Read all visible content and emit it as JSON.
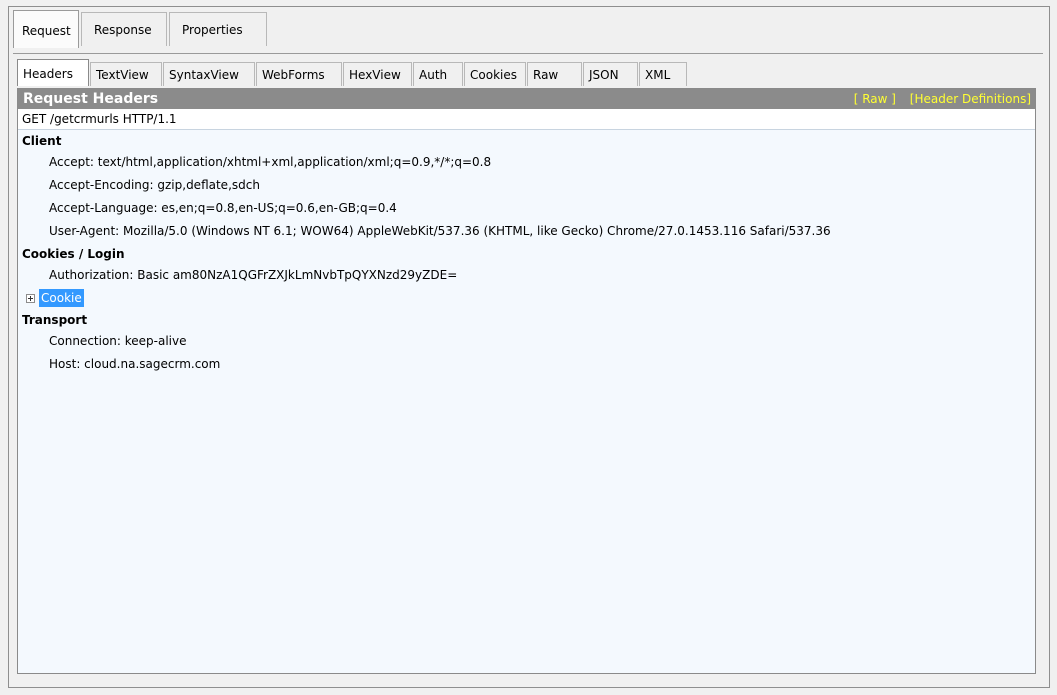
{
  "top_tabs": [
    "Request",
    "Response",
    "Properties"
  ],
  "sub_tabs": [
    "Headers",
    "TextView",
    "SyntaxView",
    "WebForms",
    "HexView",
    "Auth",
    "Cookies",
    "Raw",
    "JSON",
    "XML"
  ],
  "panel": {
    "title": "Request Headers",
    "raw_link": "[ Raw ]",
    "definitions_link": "[Header Definitions]",
    "request_line": "GET /getcrmurls HTTP/1.1"
  },
  "sections": {
    "client": {
      "title": "Client",
      "accept": "Accept: text/html,application/xhtml+xml,application/xml;q=0.9,*/*;q=0.8",
      "accept_encoding": "Accept-Encoding: gzip,deflate,sdch",
      "accept_language": "Accept-Language: es,en;q=0.8,en-US;q=0.6,en-GB;q=0.4",
      "user_agent": "User-Agent: Mozilla/5.0 (Windows NT 6.1; WOW64) AppleWebKit/537.36 (KHTML, like Gecko) Chrome/27.0.1453.116 Safari/537.36"
    },
    "cookies": {
      "title": "Cookies / Login",
      "authorization": "Authorization: Basic am80NzA1QGFrZXJkLmNvbTpQYXNzd29yZDE=",
      "cookie": "Cookie"
    },
    "transport": {
      "title": "Transport",
      "connection": "Connection: keep-alive",
      "host": "Host: cloud.na.sagecrm.com"
    }
  },
  "colors": {
    "header_bg": "#8b8b8b",
    "link_yellow": "#ffff33",
    "selection_blue": "#3399ff",
    "panel_bg": "#f4f9fe"
  }
}
